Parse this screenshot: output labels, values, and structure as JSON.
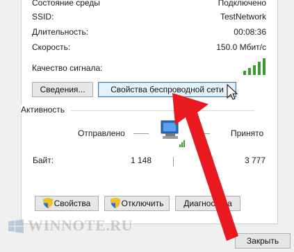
{
  "info_rows": [
    {
      "label": "Состояние среды",
      "value": "Подключено"
    },
    {
      "label": "SSID:",
      "value": "TestNetwork"
    },
    {
      "label": "Длительность:",
      "value": "00:08:36"
    },
    {
      "label": "Скорость:",
      "value": "150.0 Мбит/с"
    }
  ],
  "signal": {
    "label": "Качество сигнала:",
    "bars_filled": 5,
    "bars_total": 5,
    "color": "#3a9a2e"
  },
  "buttons": {
    "details": "Сведения...",
    "wireless_properties": "Свойства беспроводной сети"
  },
  "activity": {
    "title": "Активность",
    "sent_label": "Отправлено",
    "received_label": "Принято",
    "bytes_label": "Байт:",
    "bytes_sent": "1 148",
    "bytes_received": "3 777"
  },
  "bottom_buttons": {
    "properties": "Свойства",
    "disable": "Отключить",
    "diagnose": "Диагностика"
  },
  "close_button": "Закрыть",
  "watermark": "WINNOTE.RU",
  "colors": {
    "arrow": "#e8191f",
    "focus_border": "#3c7fb1",
    "signal_green": "#3a9a2e"
  },
  "icons": {
    "shield": "uac-shield-icon",
    "network": "network-computer-icon",
    "cursor": "mouse-pointer-icon"
  }
}
